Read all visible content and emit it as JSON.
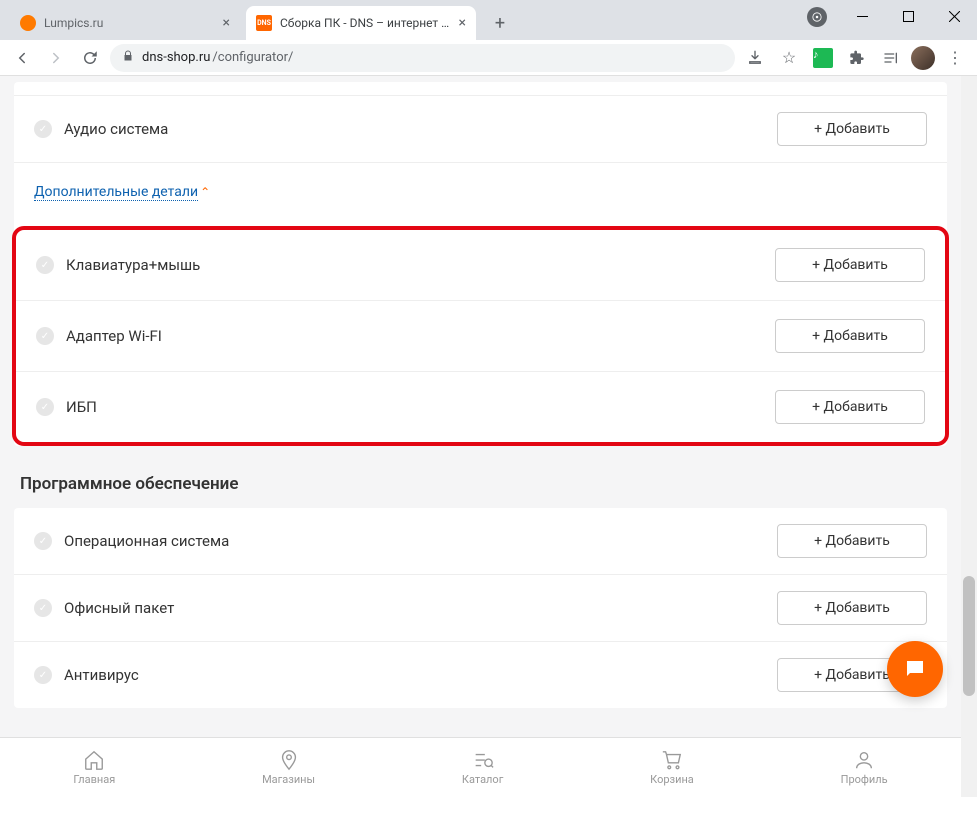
{
  "window": {
    "tabs": [
      {
        "title": "Lumpics.ru",
        "favicon": "orange",
        "active": false
      },
      {
        "title": "Сборка ПК - DNS – интернет ма",
        "favicon": "dns",
        "active": true
      }
    ],
    "url_host": "dns-shop.ru",
    "url_path": "/configurator/"
  },
  "page": {
    "audio_row": {
      "label": "Аудио система",
      "add": "+ Добавить"
    },
    "additional_link": "Дополнительные детали",
    "highlight_rows": [
      {
        "label": "Клавиатура+мышь",
        "add": "+ Добавить"
      },
      {
        "label": "Адаптер Wi-FI",
        "add": "+ Добавить"
      },
      {
        "label": "ИБП",
        "add": "+ Добавить"
      }
    ],
    "software_title": "Программное обеспечение",
    "software_rows": [
      {
        "label": "Операционная система",
        "add": "+ Добавить"
      },
      {
        "label": "Офисный пакет",
        "add": "+ Добавить"
      },
      {
        "label": "Антивирус",
        "add": "+ Добавить"
      }
    ],
    "bottom_nav": {
      "home": "Главная",
      "stores": "Магазины",
      "catalog": "Каталог",
      "cart": "Корзина",
      "profile": "Профиль"
    }
  }
}
